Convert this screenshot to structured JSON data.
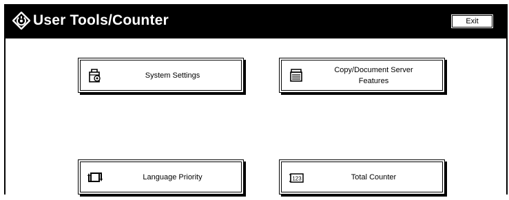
{
  "header": {
    "title": "User Tools/Counter",
    "title_icon": "user-tools-icon",
    "exit_label": "Exit"
  },
  "menu": {
    "system_settings": {
      "label": "System Settings",
      "icon": "system-settings-icon"
    },
    "copy_document_server": {
      "line1": "Copy/Document Server",
      "line2": "Features",
      "icon": "copier-icon"
    },
    "language_priority": {
      "label": "Language Priority",
      "icon": "language-switch-icon"
    },
    "total_counter": {
      "label": "Total Counter",
      "icon": "counter-icon",
      "icon_text": "123"
    }
  },
  "colors": {
    "background": "#ffffff",
    "header": "#000000",
    "text": "#000000"
  }
}
